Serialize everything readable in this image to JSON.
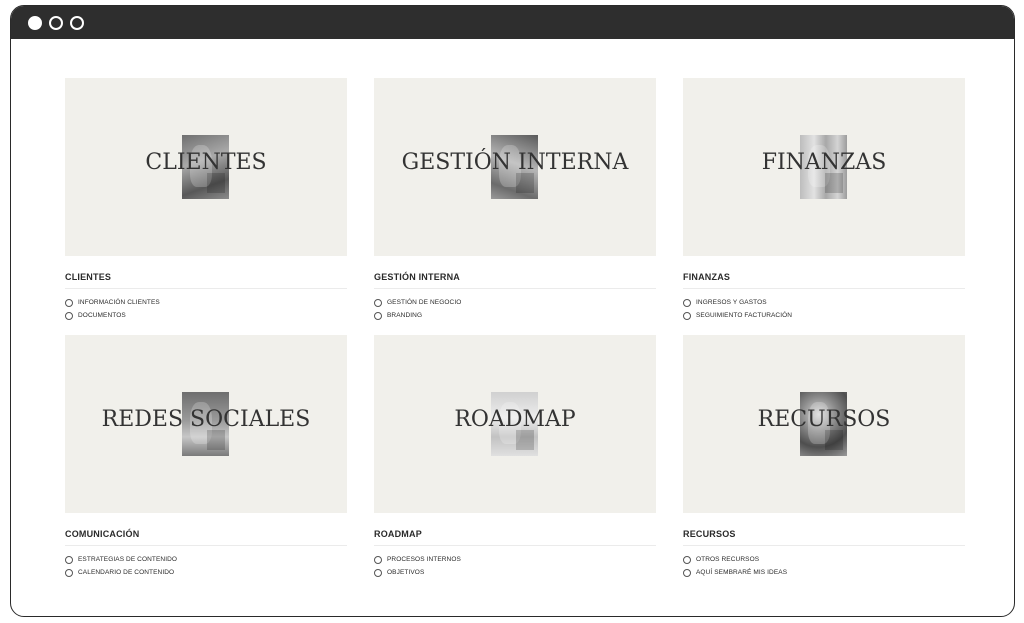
{
  "cards": [
    {
      "cover_title": "CLIENTES",
      "title": "CLIENTES",
      "items": [
        "INFORMACIÓN CLIENTES",
        "DOCUMENTOS"
      ]
    },
    {
      "cover_title": "GESTIÓN INTERNA",
      "title": "GESTIÓN INTERNA",
      "items": [
        "GESTIÓN DE NEGOCIO",
        "BRANDING"
      ]
    },
    {
      "cover_title": "FINANZAS",
      "title": "FINANZAS",
      "items": [
        "INGRESOS Y GASTOS",
        "SEGUIMIENTO FACTURACIÓN"
      ]
    },
    {
      "cover_title": "REDES SOCIALES",
      "title": "COMUNICACIÓN",
      "items": [
        "ESTRATEGIAS DE CONTENIDO",
        "CALENDARIO DE CONTENIDO"
      ]
    },
    {
      "cover_title": "ROADMAP",
      "title": "ROADMAP",
      "items": [
        "PROCESOS INTERNOS",
        "OBJETIVOS"
      ]
    },
    {
      "cover_title": "RECURSOS",
      "title": "RECURSOS",
      "items": [
        "OTROS RECURSOS",
        "AQUÍ SEMBRARÉ MIS IDEAS"
      ]
    }
  ],
  "colors": {
    "titlebar": "#2e2e2e",
    "cover_background": "#f1f0eb"
  }
}
